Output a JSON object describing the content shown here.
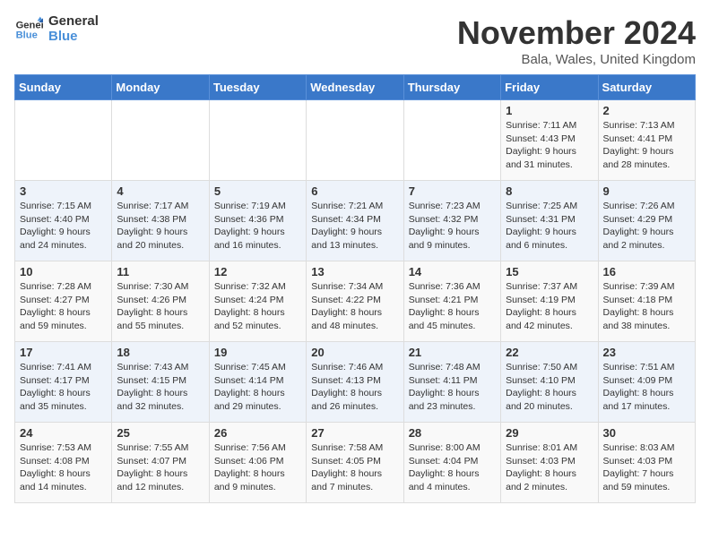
{
  "logo": {
    "line1": "General",
    "line2": "Blue"
  },
  "title": "November 2024",
  "location": "Bala, Wales, United Kingdom",
  "days_of_week": [
    "Sunday",
    "Monday",
    "Tuesday",
    "Wednesday",
    "Thursday",
    "Friday",
    "Saturday"
  ],
  "weeks": [
    [
      {
        "day": "",
        "info": ""
      },
      {
        "day": "",
        "info": ""
      },
      {
        "day": "",
        "info": ""
      },
      {
        "day": "",
        "info": ""
      },
      {
        "day": "",
        "info": ""
      },
      {
        "day": "1",
        "info": "Sunrise: 7:11 AM\nSunset: 4:43 PM\nDaylight: 9 hours\nand 31 minutes."
      },
      {
        "day": "2",
        "info": "Sunrise: 7:13 AM\nSunset: 4:41 PM\nDaylight: 9 hours\nand 28 minutes."
      }
    ],
    [
      {
        "day": "3",
        "info": "Sunrise: 7:15 AM\nSunset: 4:40 PM\nDaylight: 9 hours\nand 24 minutes."
      },
      {
        "day": "4",
        "info": "Sunrise: 7:17 AM\nSunset: 4:38 PM\nDaylight: 9 hours\nand 20 minutes."
      },
      {
        "day": "5",
        "info": "Sunrise: 7:19 AM\nSunset: 4:36 PM\nDaylight: 9 hours\nand 16 minutes."
      },
      {
        "day": "6",
        "info": "Sunrise: 7:21 AM\nSunset: 4:34 PM\nDaylight: 9 hours\nand 13 minutes."
      },
      {
        "day": "7",
        "info": "Sunrise: 7:23 AM\nSunset: 4:32 PM\nDaylight: 9 hours\nand 9 minutes."
      },
      {
        "day": "8",
        "info": "Sunrise: 7:25 AM\nSunset: 4:31 PM\nDaylight: 9 hours\nand 6 minutes."
      },
      {
        "day": "9",
        "info": "Sunrise: 7:26 AM\nSunset: 4:29 PM\nDaylight: 9 hours\nand 2 minutes."
      }
    ],
    [
      {
        "day": "10",
        "info": "Sunrise: 7:28 AM\nSunset: 4:27 PM\nDaylight: 8 hours\nand 59 minutes."
      },
      {
        "day": "11",
        "info": "Sunrise: 7:30 AM\nSunset: 4:26 PM\nDaylight: 8 hours\nand 55 minutes."
      },
      {
        "day": "12",
        "info": "Sunrise: 7:32 AM\nSunset: 4:24 PM\nDaylight: 8 hours\nand 52 minutes."
      },
      {
        "day": "13",
        "info": "Sunrise: 7:34 AM\nSunset: 4:22 PM\nDaylight: 8 hours\nand 48 minutes."
      },
      {
        "day": "14",
        "info": "Sunrise: 7:36 AM\nSunset: 4:21 PM\nDaylight: 8 hours\nand 45 minutes."
      },
      {
        "day": "15",
        "info": "Sunrise: 7:37 AM\nSunset: 4:19 PM\nDaylight: 8 hours\nand 42 minutes."
      },
      {
        "day": "16",
        "info": "Sunrise: 7:39 AM\nSunset: 4:18 PM\nDaylight: 8 hours\nand 38 minutes."
      }
    ],
    [
      {
        "day": "17",
        "info": "Sunrise: 7:41 AM\nSunset: 4:17 PM\nDaylight: 8 hours\nand 35 minutes."
      },
      {
        "day": "18",
        "info": "Sunrise: 7:43 AM\nSunset: 4:15 PM\nDaylight: 8 hours\nand 32 minutes."
      },
      {
        "day": "19",
        "info": "Sunrise: 7:45 AM\nSunset: 4:14 PM\nDaylight: 8 hours\nand 29 minutes."
      },
      {
        "day": "20",
        "info": "Sunrise: 7:46 AM\nSunset: 4:13 PM\nDaylight: 8 hours\nand 26 minutes."
      },
      {
        "day": "21",
        "info": "Sunrise: 7:48 AM\nSunset: 4:11 PM\nDaylight: 8 hours\nand 23 minutes."
      },
      {
        "day": "22",
        "info": "Sunrise: 7:50 AM\nSunset: 4:10 PM\nDaylight: 8 hours\nand 20 minutes."
      },
      {
        "day": "23",
        "info": "Sunrise: 7:51 AM\nSunset: 4:09 PM\nDaylight: 8 hours\nand 17 minutes."
      }
    ],
    [
      {
        "day": "24",
        "info": "Sunrise: 7:53 AM\nSunset: 4:08 PM\nDaylight: 8 hours\nand 14 minutes."
      },
      {
        "day": "25",
        "info": "Sunrise: 7:55 AM\nSunset: 4:07 PM\nDaylight: 8 hours\nand 12 minutes."
      },
      {
        "day": "26",
        "info": "Sunrise: 7:56 AM\nSunset: 4:06 PM\nDaylight: 8 hours\nand 9 minutes."
      },
      {
        "day": "27",
        "info": "Sunrise: 7:58 AM\nSunset: 4:05 PM\nDaylight: 8 hours\nand 7 minutes."
      },
      {
        "day": "28",
        "info": "Sunrise: 8:00 AM\nSunset: 4:04 PM\nDaylight: 8 hours\nand 4 minutes."
      },
      {
        "day": "29",
        "info": "Sunrise: 8:01 AM\nSunset: 4:03 PM\nDaylight: 8 hours\nand 2 minutes."
      },
      {
        "day": "30",
        "info": "Sunrise: 8:03 AM\nSunset: 4:03 PM\nDaylight: 7 hours\nand 59 minutes."
      }
    ]
  ]
}
